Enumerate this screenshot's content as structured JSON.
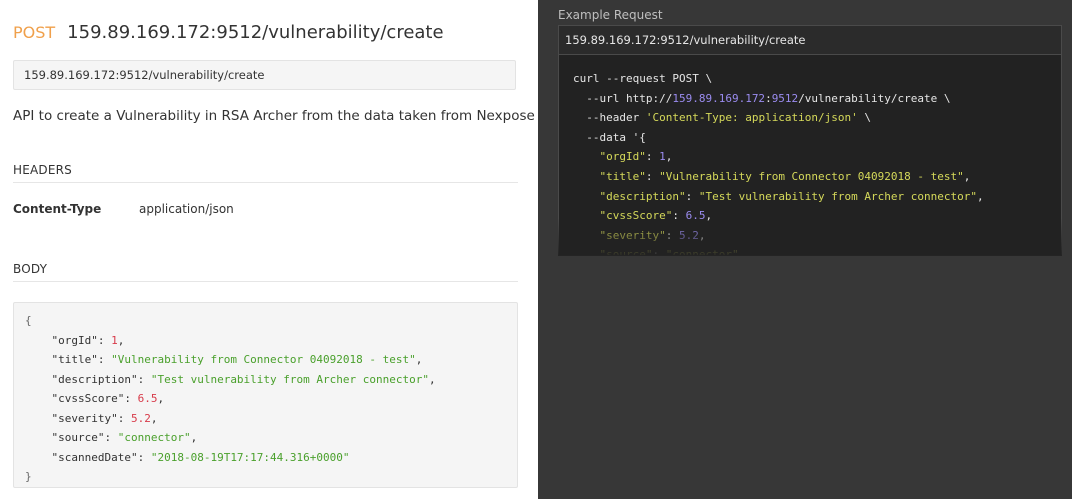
{
  "endpoint": {
    "method": "POST",
    "path": "159.89.169.172:9512/vulnerability/create"
  },
  "url": "159.89.169.172:9512/vulnerability/create",
  "description": "API to create a Vulnerability in RSA Archer from the data taken from Nexpose",
  "headers_section": {
    "title": "HEADERS",
    "items": [
      {
        "key": "Content-Type",
        "value": "application/json"
      }
    ]
  },
  "body_section": {
    "title": "BODY",
    "lines": [
      {
        "indent": "",
        "open": "{"
      },
      {
        "indent": "    ",
        "key": "\"orgId\"",
        "sep": ": ",
        "value": "1",
        "vtype": "n",
        "trail": ","
      },
      {
        "indent": "    ",
        "key": "\"title\"",
        "sep": ": ",
        "value": "\"Vulnerability from Connector 04092018 - test\"",
        "vtype": "s",
        "trail": ","
      },
      {
        "indent": "    ",
        "key": "\"description\"",
        "sep": ": ",
        "value": "\"Test vulnerability from Archer connector\"",
        "vtype": "s",
        "trail": ","
      },
      {
        "indent": "    ",
        "key": "\"cvssScore\"",
        "sep": ": ",
        "value": "6.5",
        "vtype": "n",
        "trail": ","
      },
      {
        "indent": "    ",
        "key": "\"severity\"",
        "sep": ": ",
        "value": "5.2",
        "vtype": "n",
        "trail": ","
      },
      {
        "indent": "    ",
        "key": "\"source\"",
        "sep": ": ",
        "value": "\"connector\"",
        "vtype": "s",
        "trail": ","
      },
      {
        "indent": "    ",
        "key": "\"scannedDate\"",
        "sep": ": ",
        "value": "\"2018-08-19T17:17:44.316+0000\"",
        "vtype": "s",
        "trail": ""
      },
      {
        "indent": "",
        "open": "}"
      }
    ]
  },
  "example": {
    "label": "Example Request",
    "url": "159.89.169.172:9512/vulnerability/create",
    "code": {
      "l1": "curl --request POST \\",
      "l2_pre": "  --url http://",
      "l2_ip": "159.89.169.172",
      "l2_colon": ":",
      "l2_port": "9512",
      "l2_post": "/vulnerability/create \\",
      "l3_pre": "  --header ",
      "l3_str": "'Content-Type: application/json'",
      "l3_post": " \\",
      "l4": "  --data '{",
      "fields": [
        {
          "key": "\"orgId\"",
          "value": "1",
          "vtype": "cn",
          "trail": ","
        },
        {
          "key": "\"title\"",
          "value": "\"Vulnerability from Connector 04092018 - test\"",
          "vtype": "cs",
          "trail": ","
        },
        {
          "key": "\"description\"",
          "value": "\"Test vulnerability from Archer connector\"",
          "vtype": "cs",
          "trail": ","
        },
        {
          "key": "\"cvssScore\"",
          "value": "6.5",
          "vtype": "cn",
          "trail": ","
        },
        {
          "key": "\"severity\"",
          "value": "5.2",
          "vtype": "cn",
          "trail": ","
        },
        {
          "key": "\"source\"",
          "value": "\"connector\"",
          "vtype": "cs",
          "trail": ","
        }
      ]
    }
  }
}
